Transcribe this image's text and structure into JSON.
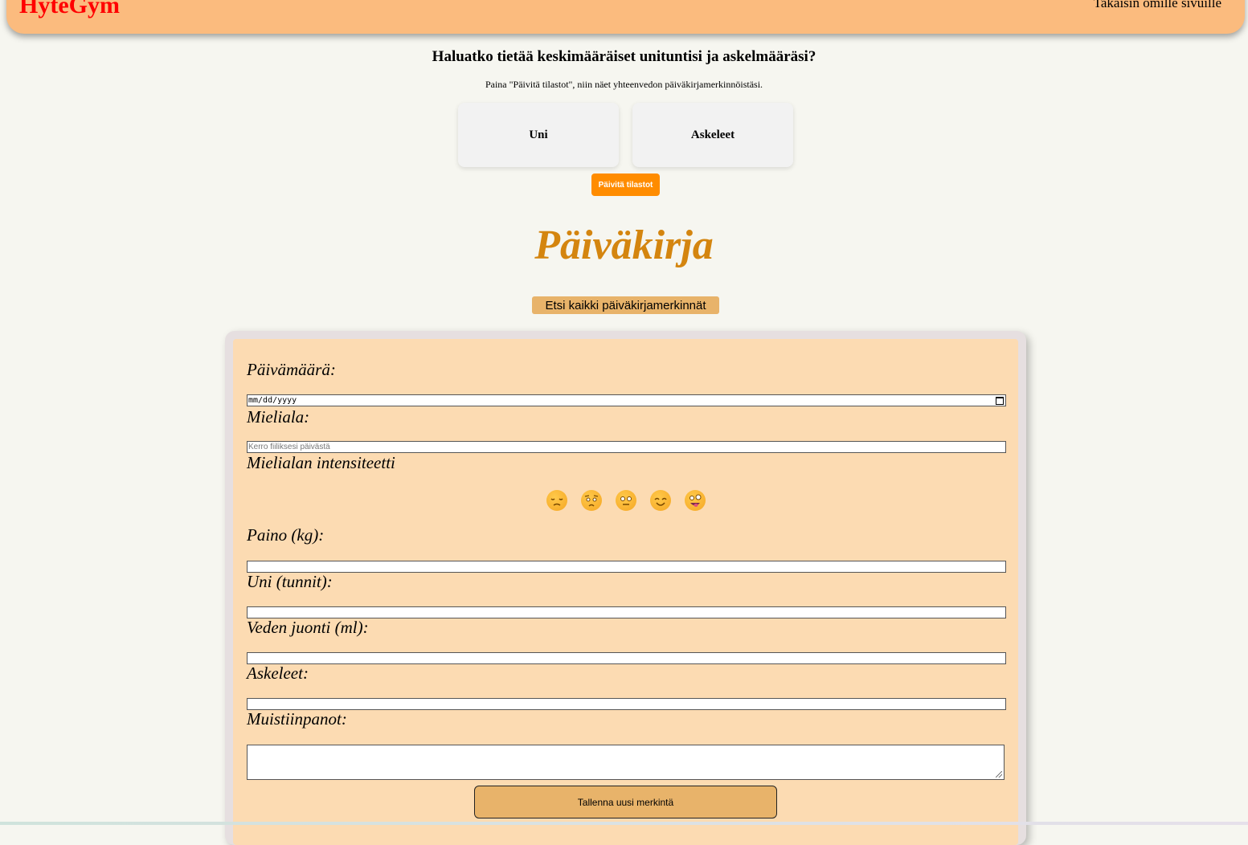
{
  "header": {
    "brand": "HyteGym",
    "back_link": "Takaisin omille sivuille"
  },
  "stats": {
    "heading": "Haluatko tietää keskimääräiset unituntisi ja askelmääräsi?",
    "subtext": "Paina \"Päivitä tilastot\", niin näet yhteenvedon päiväkirjamerkinnöistäsi.",
    "cards": [
      "Uni",
      "Askeleet"
    ],
    "update_button": "Päivitä tilastot"
  },
  "diary": {
    "title": "Päiväkirja",
    "search_all_button": "Etsi kaikki päiväkirjamerkinnät"
  },
  "form": {
    "date_label": "Päivämäärä:",
    "date_value": "mm/dd/yyyy",
    "mood_label": "Mieliala:",
    "mood_placeholder": "Kerro fiiliksesi päivästä",
    "intensity_label": "Mielialan intensiteetti",
    "intensity_emojis": [
      "pensive-face-icon",
      "worried-face-icon",
      "neutral-face-icon",
      "smiling-face-icon",
      "zany-face-icon"
    ],
    "weight_label": "Paino (kg):",
    "sleep_label": "Uni (tunnit):",
    "water_label": "Veden juonti (ml):",
    "steps_label": "Askeleet:",
    "notes_label": "Muistiinpanot:",
    "save_button": "Tallenna uusi merkintä"
  },
  "colors": {
    "header_bg": "#fbbb7e",
    "brand": "#ff0000",
    "update_button": "#ff8c00",
    "diary_title": "#d4850f",
    "accent_button": "#e8b36a",
    "form_bg": "#fcdbb2",
    "page_bg": "#f6f6f0"
  }
}
